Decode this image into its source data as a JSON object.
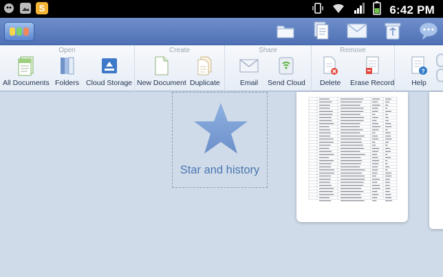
{
  "status_bar": {
    "time": "6:42 PM",
    "left_icons": [
      "android-icon",
      "gallery-icon",
      "s-app-icon"
    ],
    "right_icons": [
      "vibrate-icon",
      "wifi-icon",
      "signal-icon",
      "battery-icon"
    ]
  },
  "app_bar": {
    "logo": "app-logo",
    "actions": [
      "folder-icon",
      "documents-icon",
      "email-icon",
      "recycle-bin-icon",
      "chat-icon"
    ]
  },
  "ribbon": {
    "groups": [
      {
        "title": "Open",
        "buttons": [
          {
            "label": "All Documents",
            "icon": "all-documents-icon"
          },
          {
            "label": "Folders",
            "icon": "folders-icon"
          },
          {
            "label": "Cloud Storage",
            "icon": "cloud-storage-icon"
          }
        ]
      },
      {
        "title": "Create",
        "buttons": [
          {
            "label": "New Document",
            "icon": "new-document-icon"
          },
          {
            "label": "Duplicate",
            "icon": "duplicate-icon"
          }
        ]
      },
      {
        "title": "Share",
        "buttons": [
          {
            "label": "Email",
            "icon": "email-icon"
          },
          {
            "label": "Send Cloud",
            "icon": "send-cloud-icon"
          }
        ]
      },
      {
        "title": "Remove",
        "buttons": [
          {
            "label": "Delete",
            "icon": "delete-icon"
          },
          {
            "label": "Erase Record",
            "icon": "erase-record-icon"
          }
        ]
      },
      {
        "title": "",
        "buttons": [
          {
            "label": "Help",
            "icon": "help-icon"
          }
        ]
      }
    ]
  },
  "content": {
    "star_label": "Star and history"
  },
  "colors": {
    "background": "#cfdbe9",
    "appbar": "#5a7cbf",
    "star": "#7d9fd4",
    "label": "#4a76b0"
  }
}
